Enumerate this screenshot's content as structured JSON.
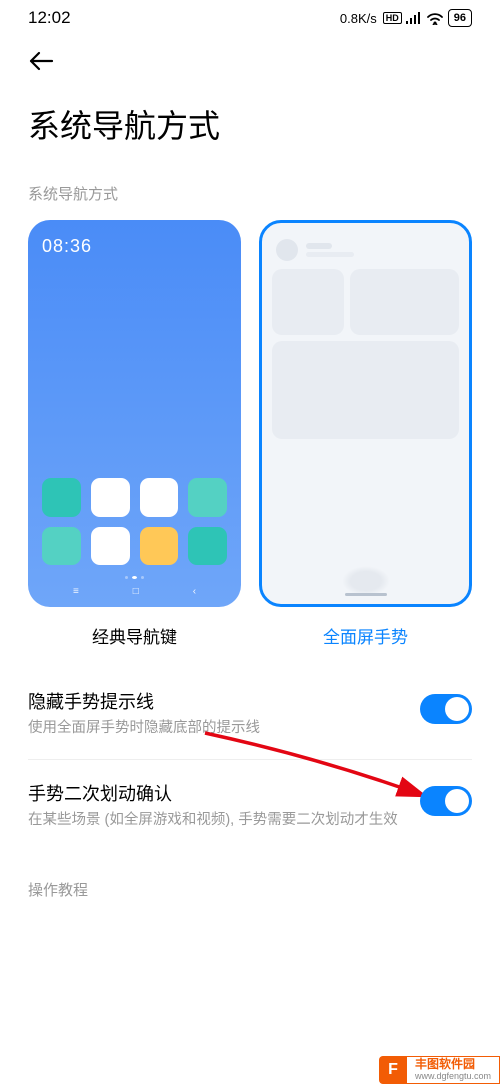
{
  "status": {
    "time": "12:02",
    "speed": "0.8K/s",
    "hd": "HD",
    "battery": "96"
  },
  "page": {
    "title": "系统导航方式",
    "section_header": "系统导航方式"
  },
  "preview": {
    "homescreen_time": "08:36",
    "classic_label": "经典导航键",
    "gesture_label": "全面屏手势"
  },
  "settings": {
    "hide_bar": {
      "title": "隐藏手势提示线",
      "desc": "使用全面屏手势时隐藏底部的提示线",
      "enabled": true
    },
    "double_swipe": {
      "title": "手势二次划动确认",
      "desc": "在某些场景 (如全屏游戏和视频), 手势需要二次划动才生效",
      "enabled": true
    }
  },
  "tutorial_header": "操作教程",
  "watermark": {
    "brand": "丰图软件园",
    "url": "www.dgfengtu.com"
  },
  "colors": {
    "accent": "#0A84FF"
  }
}
